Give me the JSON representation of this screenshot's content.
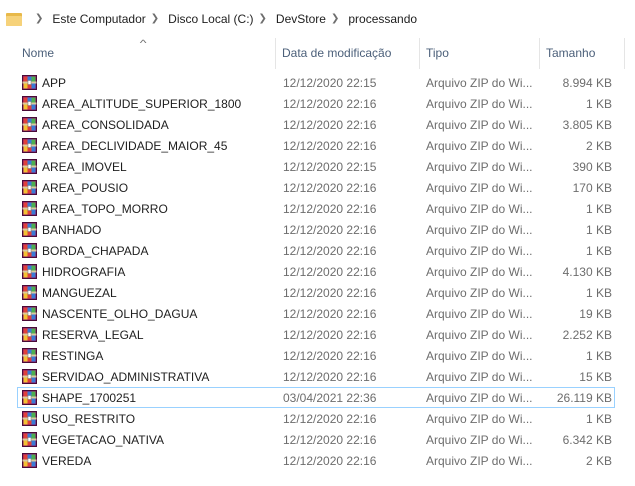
{
  "breadcrumb": [
    "Este Computador",
    "Disco Local (C:)",
    "DevStore",
    "processando"
  ],
  "columns": {
    "name": "Nome",
    "date": "Data de modificação",
    "type": "Tipo",
    "size": "Tamanho"
  },
  "files": [
    {
      "name": "APP",
      "date": "12/12/2020 22:15",
      "type": "Arquivo ZIP do Wi...",
      "size": "8.994 KB"
    },
    {
      "name": "AREA_ALTITUDE_SUPERIOR_1800",
      "date": "12/12/2020 22:16",
      "type": "Arquivo ZIP do Wi...",
      "size": "1 KB"
    },
    {
      "name": "AREA_CONSOLIDADA",
      "date": "12/12/2020 22:16",
      "type": "Arquivo ZIP do Wi...",
      "size": "3.805 KB"
    },
    {
      "name": "AREA_DECLIVIDADE_MAIOR_45",
      "date": "12/12/2020 22:16",
      "type": "Arquivo ZIP do Wi...",
      "size": "2 KB"
    },
    {
      "name": "AREA_IMOVEL",
      "date": "12/12/2020 22:15",
      "type": "Arquivo ZIP do Wi...",
      "size": "390 KB"
    },
    {
      "name": "AREA_POUSIO",
      "date": "12/12/2020 22:16",
      "type": "Arquivo ZIP do Wi...",
      "size": "170 KB"
    },
    {
      "name": "AREA_TOPO_MORRO",
      "date": "12/12/2020 22:16",
      "type": "Arquivo ZIP do Wi...",
      "size": "1 KB"
    },
    {
      "name": "BANHADO",
      "date": "12/12/2020 22:16",
      "type": "Arquivo ZIP do Wi...",
      "size": "1 KB"
    },
    {
      "name": "BORDA_CHAPADA",
      "date": "12/12/2020 22:16",
      "type": "Arquivo ZIP do Wi...",
      "size": "1 KB"
    },
    {
      "name": "HIDROGRAFIA",
      "date": "12/12/2020 22:16",
      "type": "Arquivo ZIP do Wi...",
      "size": "4.130 KB"
    },
    {
      "name": "MANGUEZAL",
      "date": "12/12/2020 22:16",
      "type": "Arquivo ZIP do Wi...",
      "size": "1 KB"
    },
    {
      "name": "NASCENTE_OLHO_DAGUA",
      "date": "12/12/2020 22:16",
      "type": "Arquivo ZIP do Wi...",
      "size": "19 KB"
    },
    {
      "name": "RESERVA_LEGAL",
      "date": "12/12/2020 22:16",
      "type": "Arquivo ZIP do Wi...",
      "size": "2.252 KB"
    },
    {
      "name": "RESTINGA",
      "date": "12/12/2020 22:16",
      "type": "Arquivo ZIP do Wi...",
      "size": "1 KB"
    },
    {
      "name": "SERVIDAO_ADMINISTRATIVA",
      "date": "12/12/2020 22:16",
      "type": "Arquivo ZIP do Wi...",
      "size": "15 KB"
    },
    {
      "name": "SHAPE_1700251",
      "date": "03/04/2021 22:36",
      "type": "Arquivo ZIP do Wi...",
      "size": "26.119 KB",
      "selected": true
    },
    {
      "name": "USO_RESTRITO",
      "date": "12/12/2020 22:16",
      "type": "Arquivo ZIP do Wi...",
      "size": "1 KB"
    },
    {
      "name": "VEGETACAO_NATIVA",
      "date": "12/12/2020 22:16",
      "type": "Arquivo ZIP do Wi...",
      "size": "6.342 KB"
    },
    {
      "name": "VEREDA",
      "date": "12/12/2020 22:16",
      "type": "Arquivo ZIP do Wi...",
      "size": "2 KB"
    }
  ],
  "icons": {
    "file": "winrar-archive-icon",
    "location": "folder-icon",
    "separator": "chevron-right-icon",
    "sort": "sort-ascending-icon"
  }
}
